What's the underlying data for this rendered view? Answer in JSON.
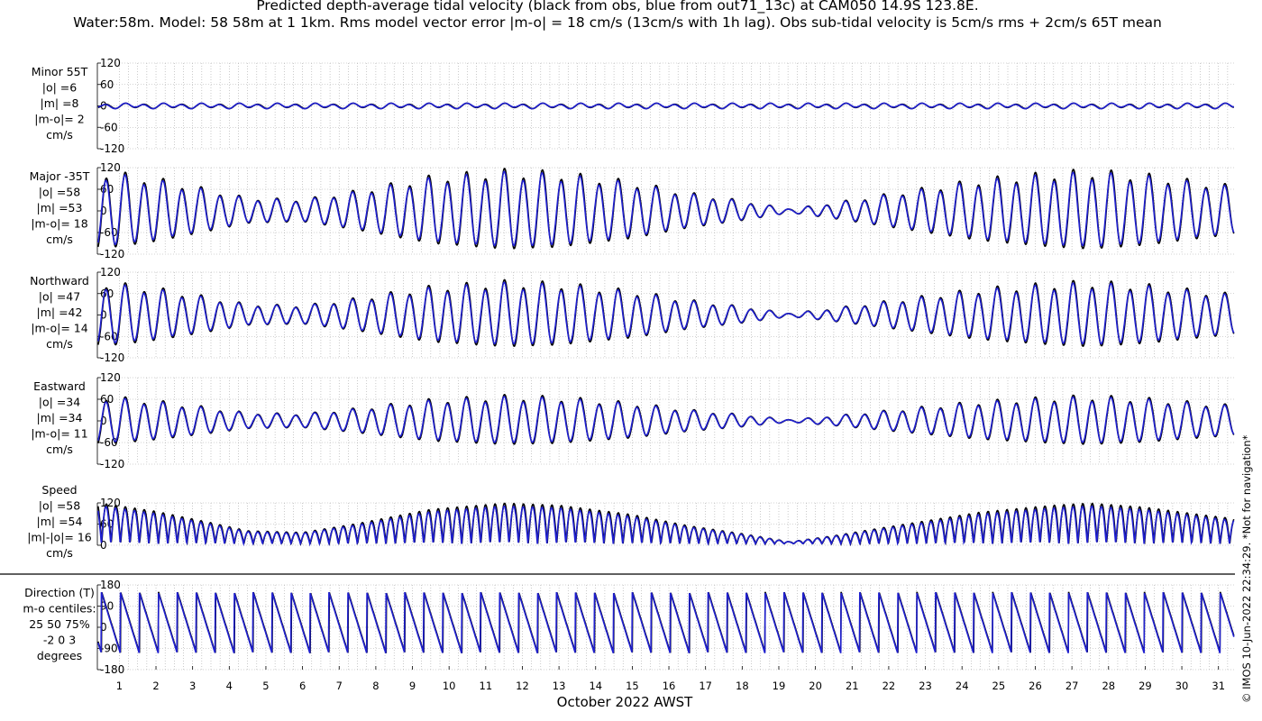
{
  "title_line1": "Predicted depth-average tidal velocity (black from obs, blue from out71_13c) at CAM050 14.9S 123.8E.",
  "title_line2": "Water:58m. Model: 58 58m at 1 1km. Rms model vector error |m-o| = 18 cm/s (13cm/s with 1h lag). Obs sub-tidal velocity is 5cm/s rms + 2cm/s 65T mean",
  "stamp": "© IMOS 10-Jun-2022 22:34:29. *Not for navigation*",
  "colors": {
    "obs": "#000000",
    "model": "#1f1fd0",
    "grid": "#a8a8a8"
  },
  "chart_data": {
    "type": "line",
    "xlabel": "October 2022 AWST",
    "x_ticks": [
      "1",
      "2",
      "3",
      "4",
      "5",
      "6",
      "7",
      "8",
      "9",
      "10",
      "11",
      "12",
      "13",
      "14",
      "15",
      "16",
      "17",
      "18",
      "19",
      "20",
      "21",
      "22",
      "23",
      "24",
      "25",
      "26",
      "27",
      "28",
      "29",
      "30",
      "31"
    ],
    "xlim_days": [
      0.4,
      31.45
    ],
    "grid": true,
    "series_colors": {
      "obs": "black",
      "model": "blue"
    },
    "panels": [
      {
        "key": "minor",
        "label_lines": [
          "Minor 55T",
          "|o| =6",
          "|m| =8",
          "|m-o|= 2",
          "cm/s"
        ],
        "yticks": [
          "120",
          "60",
          "0",
          "-60",
          "-120"
        ],
        "ylim": [
          -120,
          120
        ],
        "amp_max": 10,
        "kind": "signed"
      },
      {
        "key": "major",
        "label_lines": [
          "Major -35T",
          "|o| =58",
          "|m| =53",
          "|m-o|= 18",
          "cm/s"
        ],
        "yticks": [
          "120",
          "60",
          "0",
          "-60",
          "-120"
        ],
        "ylim": [
          -120,
          120
        ],
        "amp_max": 105,
        "kind": "signed"
      },
      {
        "key": "north",
        "label_lines": [
          "Northward",
          "|o| =47",
          "|m| =42",
          "|m-o|= 14",
          "cm/s"
        ],
        "yticks": [
          "120",
          "60",
          "0",
          "-60",
          "-120"
        ],
        "ylim": [
          -120,
          120
        ],
        "amp_max": 88,
        "kind": "signed"
      },
      {
        "key": "east",
        "label_lines": [
          "Eastward",
          "|o| =34",
          "|m| =34",
          "|m-o|= 11",
          "cm/s"
        ],
        "yticks": [
          "120",
          "60",
          "0",
          "-60",
          "-120"
        ],
        "ylim": [
          -120,
          120
        ],
        "amp_max": 65,
        "kind": "signed"
      },
      {
        "key": "speed",
        "label_lines": [
          "Speed",
          "|o| =58",
          "|m| =54",
          "|m|-|o|= 16",
          "cm/s"
        ],
        "yticks": [
          "120",
          "60",
          "0"
        ],
        "ylim": [
          0,
          120
        ],
        "amp_max": 115,
        "kind": "speed"
      },
      {
        "key": "direction",
        "label_lines": [
          "Direction (T)",
          "m-o centiles:",
          "25  50  75%",
          "-2  0  3",
          "degrees"
        ],
        "yticks": [
          "180",
          "90",
          "0",
          "-90",
          "-180"
        ],
        "ylim": [
          -180,
          180
        ],
        "kind": "direction"
      }
    ],
    "spring_neap_envelope_cm_s": {
      "day": [
        0.5,
        2,
        3.5,
        4.5,
        6,
        7.5,
        9.5,
        11.5,
        13,
        15,
        16.5,
        18,
        19.3,
        20.5,
        22,
        24.5,
        26.5,
        27.5,
        29,
        30.5,
        31.4
      ],
      "relative_amplitude": [
        1.0,
        0.8,
        0.52,
        0.32,
        0.28,
        0.5,
        0.85,
        1.0,
        0.95,
        0.72,
        0.45,
        0.25,
        0.05,
        0.2,
        0.42,
        0.78,
        0.95,
        1.0,
        0.9,
        0.72,
        0.62
      ]
    }
  }
}
